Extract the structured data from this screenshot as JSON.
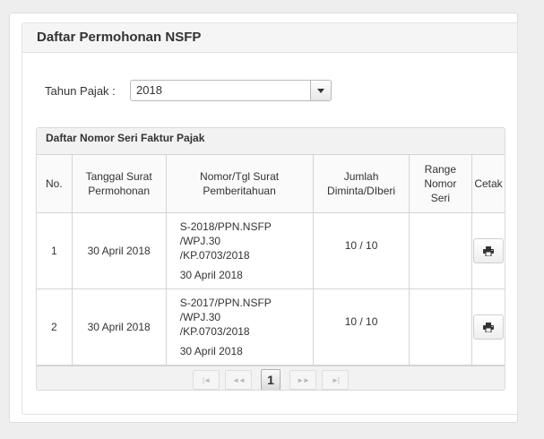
{
  "panel": {
    "title": "Daftar Permohonan NSFP"
  },
  "filter": {
    "label": "Tahun Pajak :",
    "selected": "2018"
  },
  "grid": {
    "title": "Daftar Nomor Seri Faktur Pajak",
    "columns": {
      "no": "No.",
      "tanggal": [
        "Tanggal Surat",
        "Permohonan"
      ],
      "nomor": [
        "Nomor/Tgl Surat",
        "Pemberitahuan"
      ],
      "jumlah": [
        "Jumlah",
        "Diminta/DIberi"
      ],
      "range": [
        "Range",
        "Nomor",
        "Seri"
      ],
      "cetak": "Cetak"
    },
    "rows": [
      {
        "no": "1",
        "tanggal": "30 April 2018",
        "nomor_lines": [
          "S-2018/PPN.NSFP",
          "/WPJ.30",
          "/KP.0703/2018"
        ],
        "nomor_date": "30 April 2018",
        "jumlah": "10 / 10",
        "range": ""
      },
      {
        "no": "2",
        "tanggal": "30 April 2018",
        "nomor_lines": [
          "S-2017/PPN.NSFP",
          "/WPJ.30",
          "/KP.0703/2018"
        ],
        "nomor_date": "30 April 2018",
        "jumlah": "10 / 10",
        "range": ""
      }
    ]
  },
  "pager": {
    "first": "|◄",
    "prev": "◄◄",
    "current": "1",
    "next": "►►",
    "last": "►|"
  },
  "icons": {
    "print": "printer-icon",
    "dropdown": "chevron-down-icon"
  }
}
